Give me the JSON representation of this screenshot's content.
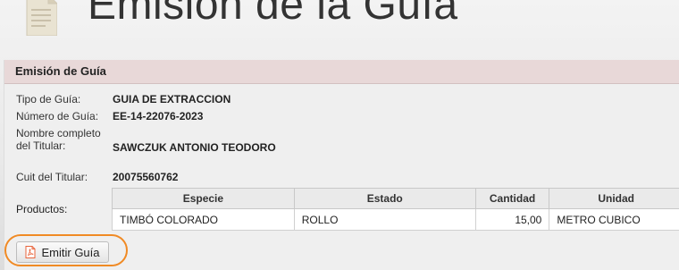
{
  "page": {
    "title": "Emisión de la Guía"
  },
  "panel": {
    "header": "Emisión de Guía",
    "fields": [
      {
        "label": "Tipo de Guía:",
        "value": "GUIA DE EXTRACCION"
      },
      {
        "label": "Número de Guía:",
        "value": "EE-14-22076-2023"
      },
      {
        "label": "Nombre completo del Titular:",
        "value": "SAWCZUK ANTONIO TEODORO"
      },
      {
        "label": "Cuit del Titular:",
        "value": "20075560762"
      }
    ],
    "products_label": "Productos:",
    "table": {
      "headers": [
        "Especie",
        "Estado",
        "Cantidad",
        "Unidad"
      ],
      "rows": [
        [
          "TIMBÓ COLORADO",
          "ROLLO",
          "15,00",
          "METRO CUBICO"
        ]
      ]
    }
  },
  "actions": {
    "emit_label": "Emitir Guía"
  },
  "colors": {
    "highlight": "#f08a24",
    "header_bg": "#e8d8d8",
    "pdf_icon": "#e8643c"
  },
  "icons": {
    "title": "document-icon",
    "button": "pdf-file-icon"
  }
}
